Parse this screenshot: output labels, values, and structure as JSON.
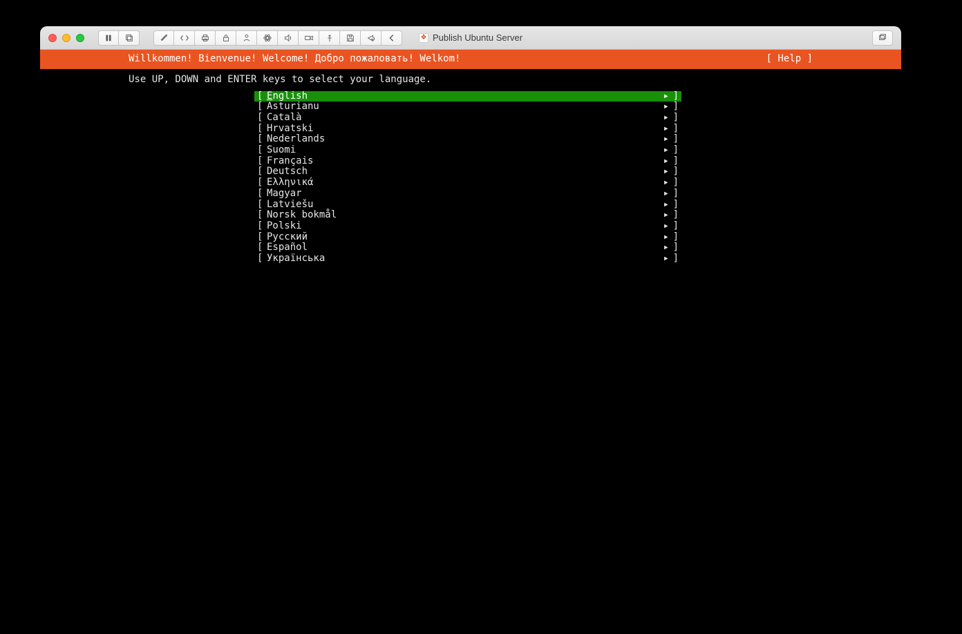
{
  "window": {
    "title": "Publish Ubuntu Server"
  },
  "toolbar_icons": [
    "pause-icon",
    "snapshot-icon",
    "wrench-icon",
    "code-icon",
    "printer-icon",
    "lock-icon",
    "person-icon",
    "atom-icon",
    "sound-icon",
    "camera-icon",
    "usb-icon",
    "floppy-icon",
    "share-icon",
    "chevron-left-icon",
    "windows-icon"
  ],
  "installer": {
    "welcome_line": "Willkommen! Bienvenue! Welcome! Добро пожаловать! Welkom!",
    "help_label": "[ Help ]",
    "instruction": "Use UP, DOWN and ENTER keys to select your language.",
    "languages": [
      {
        "label": "English",
        "selected": true
      },
      {
        "label": "Asturianu",
        "selected": false
      },
      {
        "label": "Català",
        "selected": false
      },
      {
        "label": "Hrvatski",
        "selected": false
      },
      {
        "label": "Nederlands",
        "selected": false
      },
      {
        "label": "Suomi",
        "selected": false
      },
      {
        "label": "Français",
        "selected": false
      },
      {
        "label": "Deutsch",
        "selected": false
      },
      {
        "label": "Ελληνικά",
        "selected": false
      },
      {
        "label": "Magyar",
        "selected": false
      },
      {
        "label": "Latviešu",
        "selected": false
      },
      {
        "label": "Norsk bokmål",
        "selected": false
      },
      {
        "label": "Polski",
        "selected": false
      },
      {
        "label": "Русский",
        "selected": false
      },
      {
        "label": "Español",
        "selected": false
      },
      {
        "label": "Українська",
        "selected": false
      }
    ]
  }
}
